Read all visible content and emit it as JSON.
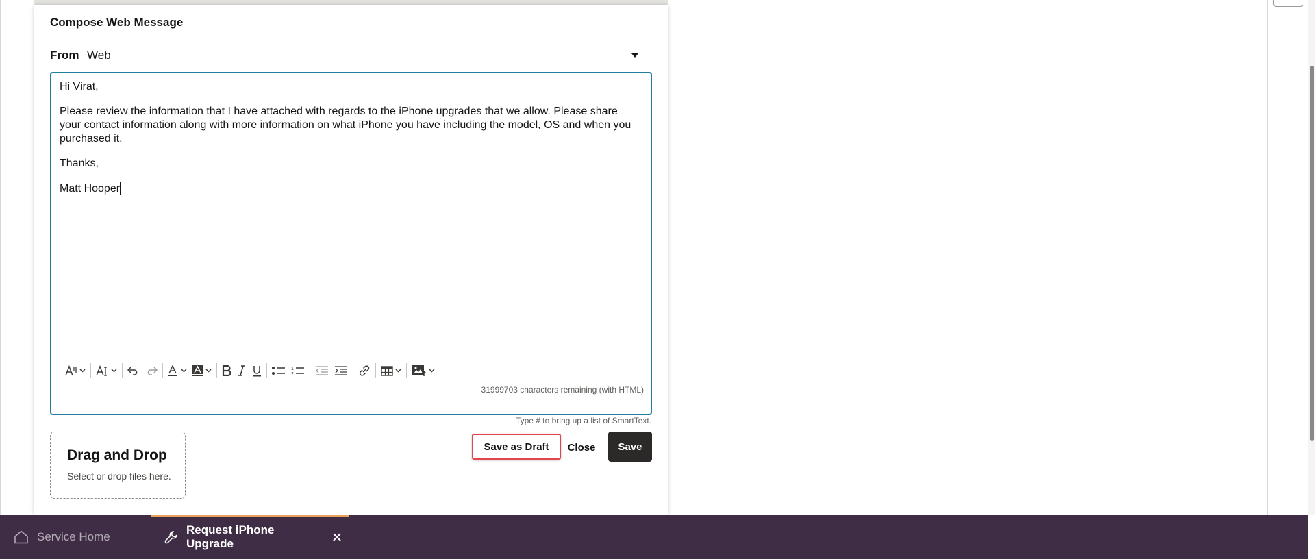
{
  "dialog": {
    "title": "Compose Web Message",
    "from_label": "From",
    "from_value": "Web"
  },
  "editor": {
    "greeting": "Hi Virat,",
    "body": "Please review the information that I have attached with regards to the iPhone upgrades that we allow. Please share your contact information along with more information on what iPhone you have including the model, OS and when you purchased it.",
    "closing": "Thanks,",
    "signature": "Matt Hooper",
    "characters_remaining": "31999703 characters remaining (with HTML)",
    "toolbar": [
      "font-style-icon",
      "font-size-icon",
      "undo-icon",
      "redo-icon",
      "text-color-icon",
      "highlight-color-icon",
      "bold-icon",
      "italic-icon",
      "underline-icon",
      "bulleted-list-icon",
      "numbered-list-icon",
      "outdent-icon",
      "indent-icon",
      "link-icon",
      "table-icon",
      "insert-image-icon"
    ]
  },
  "smarttext_hint": "Type # to bring up a list of SmartText.",
  "dropzone": {
    "title": "Drag and Drop",
    "subtitle": "Select or drop files here."
  },
  "actions": {
    "save_draft": "Save as Draft",
    "close": "Close",
    "save": "Save"
  },
  "bottom_tabs": {
    "home": "Service Home",
    "active": "Request iPhone Upgrade"
  },
  "colors": {
    "editor_border": "#227e9e",
    "bottom_bar": "#3e2d44",
    "active_tab_accent": "#e9a15b",
    "highlight_box": "#e0464a",
    "save_button": "#2b2a28"
  }
}
